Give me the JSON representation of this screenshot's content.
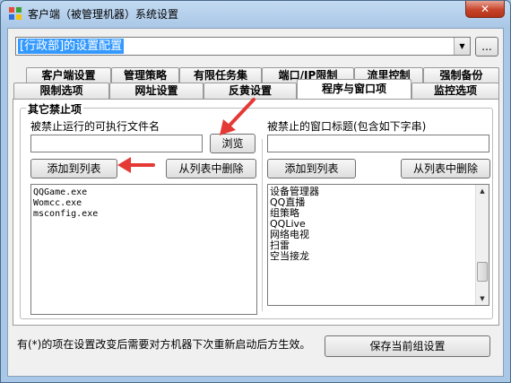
{
  "window": {
    "title": "客户端（被管理机器）系统设置",
    "close_label": "✕"
  },
  "department": {
    "selected": "[行政部]的设置配置",
    "more_label": "..."
  },
  "tabs_row1": [
    "客户端设置",
    "管理策略",
    "有限任务集",
    "端口/IP限制",
    "流里控制",
    "强制备份"
  ],
  "tabs_row2": [
    "限制选项",
    "网址设置",
    "反黄设置",
    "程序与窗口项",
    "监控选项"
  ],
  "active_tab": "程序与窗口项",
  "group": {
    "title": "其它禁止项",
    "left": {
      "label": "被禁止运行的可执行文件名",
      "input_value": "",
      "browse_label": "浏览",
      "add_label": "添加到列表",
      "remove_label": "从列表中删除",
      "items": [
        "QQGame.exe",
        "Womcc.exe",
        "msconfig.exe"
      ]
    },
    "right": {
      "label": "被禁止的窗口标题(包含如下字串)",
      "input_value": "",
      "add_label": "添加到列表",
      "remove_label": "从列表中删除",
      "items": [
        "设备管理器",
        "QQ直播",
        "组策略",
        "QQLive",
        "网络电视",
        "扫雷",
        "空当接龙"
      ]
    }
  },
  "footer": {
    "note": "有(*)的项在设置改变后需要对方机器下次重新启动后方生效。",
    "save_label": "保存当前组设置"
  },
  "colors": {
    "selection": "#3399ff",
    "annotation_arrow": "#e53935",
    "close_button": "#c7442b"
  }
}
